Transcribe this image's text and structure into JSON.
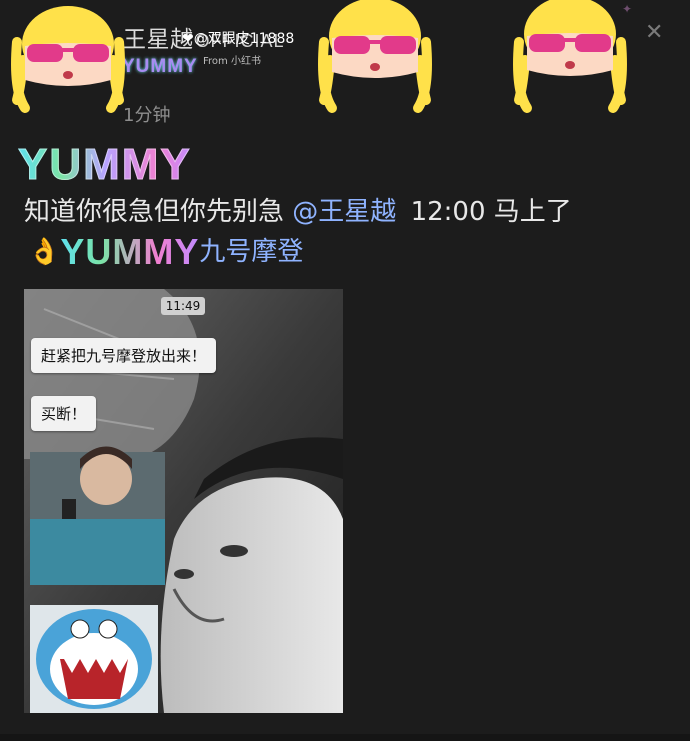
{
  "header": {
    "username": "王星越",
    "username_brand": "OFFICIAL",
    "watermark": "@双眼皮11888",
    "watermark_source": "From 小红书",
    "nickname_sticker_text": "YUMMY",
    "time_ago": "1分钟"
  },
  "post": {
    "sticker_text": "YUMMY",
    "line1_text": "知道你很急但你先别急",
    "mention": "@王星越",
    "line1_time": "12:00 马上了",
    "line2_emoji": "👌",
    "line2_sticker": "YUMMY",
    "line2_text": "九号摩登"
  },
  "image": {
    "chat_time": "11:49",
    "bubble1": "赶紧把九号摩登放出来！",
    "bubble2": "买断！"
  },
  "icons": {
    "close": "close-icon",
    "sparkle": "sparkle-icon",
    "sticker": "cartoon-girl-sunglasses-sticker"
  },
  "colors": {
    "background": "#1c1c1c",
    "mention": "#8fb3ff",
    "sticker_pink": "#e23a8a",
    "sticker_yellow": "#ffe14a"
  }
}
